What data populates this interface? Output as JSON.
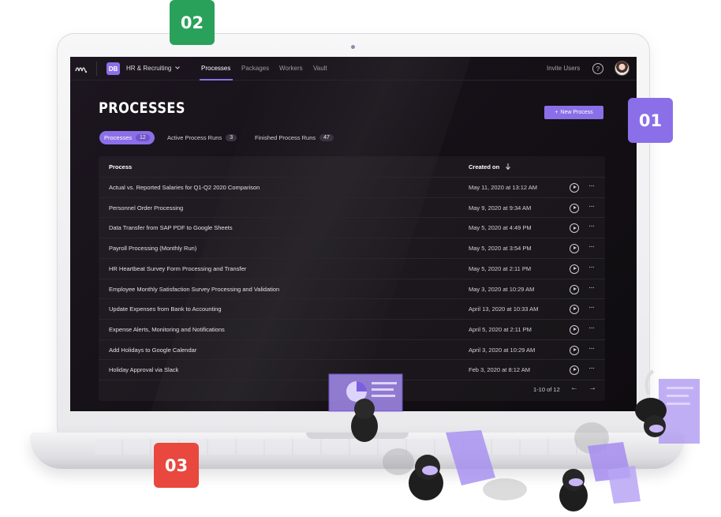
{
  "badges": {
    "step1": "01",
    "step2": "02",
    "step3": "03"
  },
  "topbar": {
    "workspace_initials": "DB",
    "workspace_name": "HR & Recruiting",
    "nav": [
      "Processes",
      "Packages",
      "Workers",
      "Vault"
    ],
    "invite_label": "Invite Users",
    "help_glyph": "?"
  },
  "page": {
    "title": "PROCESSES",
    "new_button": "New Process",
    "new_button_glyph": "+"
  },
  "tabs": [
    {
      "label": "Processes",
      "count": "12",
      "active": true
    },
    {
      "label": "Active Process Runs",
      "count": "3",
      "active": false
    },
    {
      "label": "Finished Process Runs",
      "count": "47",
      "active": false
    }
  ],
  "table": {
    "headers": {
      "process": "Process",
      "created": "Created on"
    },
    "rows": [
      {
        "name": "Actual vs. Reported Salaries for Q1-Q2 2020  Comparison",
        "date": "May 11, 2020 at 13:12 AM"
      },
      {
        "name": "Personnel Order Processing",
        "date": "May 9, 2020 at 9:34 AM"
      },
      {
        "name": "Data Transfer from SAP PDF to Google Sheets",
        "date": "May 5, 2020 at 4:49 PM"
      },
      {
        "name": "Payroll Processing (Monthly Run)",
        "date": "May 5, 2020 at 3:54 PM"
      },
      {
        "name": "HR Heartbeat Survey Form Processing and Transfer",
        "date": "May 5, 2020 at 2:11 PM"
      },
      {
        "name": "Employee Monthly Satisfaction Survey Processing and Validation",
        "date": "May 3, 2020 at 10:29 AM"
      },
      {
        "name": "Update Expenses from Bank to Accounting",
        "date": "April 13, 2020 at 10:33 AM"
      },
      {
        "name": "Expense Alerts, Monitoring and Notifications",
        "date": "April 5, 2020 at 2:11 PM"
      },
      {
        "name": "Add Holidays to Google Calendar",
        "date": "April 3, 2020 at 10:29 AM"
      },
      {
        "name": "Holiday Approval via Slack",
        "date": "Feb 3, 2020 at 8:12 AM"
      }
    ],
    "pagination": "1-10 of 12",
    "prev_glyph": "←",
    "next_glyph": "→",
    "more_glyph": "···"
  },
  "colors": {
    "accent": "#8b6fe8",
    "step2": "#2aa15a",
    "step3": "#e8483e",
    "screen_bg": "#141016"
  },
  "icons": [
    "logo-icon",
    "chevron-down-icon",
    "help-icon",
    "avatar",
    "sort-down-icon",
    "play-icon",
    "more-icon",
    "arrow-left-icon",
    "arrow-right-icon"
  ]
}
